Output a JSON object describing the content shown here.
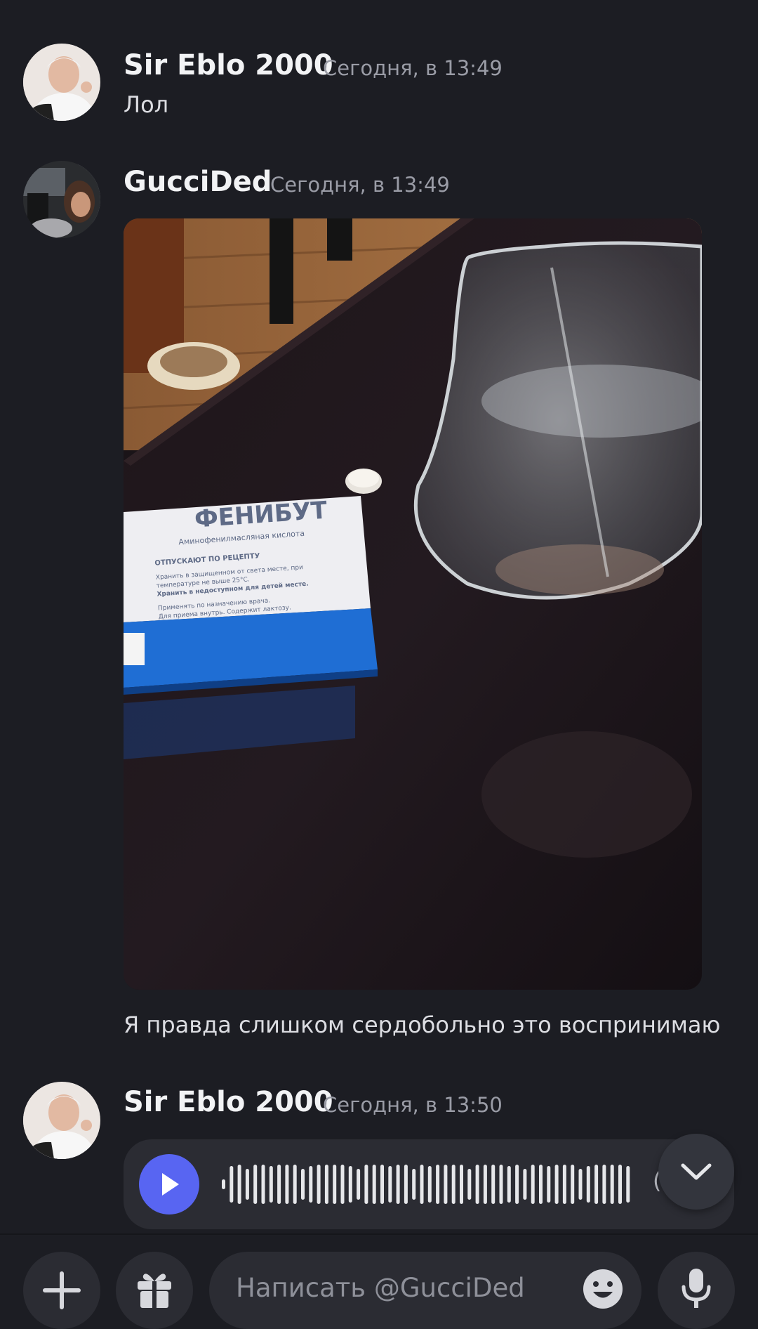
{
  "messages": [
    {
      "author": "Sir Eblo 2000",
      "timestamp": "Сегодня, в 13:49",
      "text": "Лол"
    },
    {
      "author": "GucciDed",
      "timestamp": "Сегодня, в 13:49",
      "attachment": {
        "type": "image",
        "box_title": "ФЕНИБУТ",
        "box_subtitle": "Аминофенилмасляная кислота",
        "box_lines": [
          "ОТПУСКАЮТ ПО РЕЦЕПТУ",
          "Хранить в защищенном от света месте, при",
          "температуре не выше 25°С.",
          "Хранить в недоступном для детей месте.",
          "Применять по назначению врача.",
          "Для приема внутрь. Содержит лактозу."
        ]
      },
      "text": "Я правда слишком сердобольно это воспринимаю"
    },
    {
      "author": "Sir Eblo 2000",
      "timestamp": "Сегодня, в 13:50",
      "voice": {
        "duration_partial": "("
      }
    }
  ],
  "composer": {
    "placeholder": "Написать @GucciDed"
  },
  "icons": {
    "play": "play-icon",
    "scroll_down": "chevron-down-icon",
    "add": "plus-icon",
    "gift": "gift-icon",
    "emoji": "emoji-icon",
    "mic": "microphone-icon"
  },
  "colors": {
    "background": "#1c1d23",
    "accent": "#5865f2",
    "surface": "#2b2c33"
  }
}
